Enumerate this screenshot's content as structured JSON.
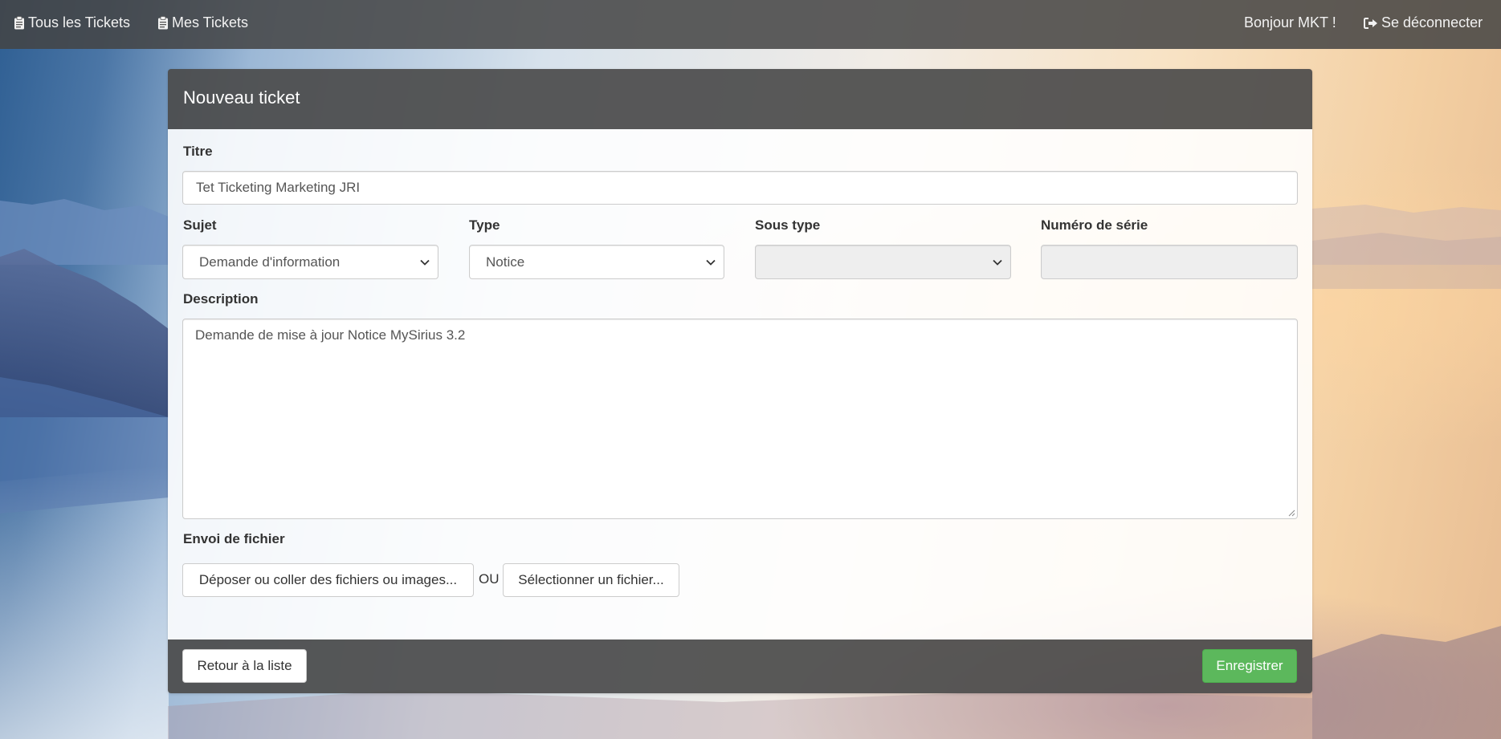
{
  "nav": {
    "all_tickets": "Tous les Tickets",
    "my_tickets": "Mes Tickets",
    "greeting": "Bonjour MKT !",
    "logout": "Se déconnecter"
  },
  "panel": {
    "title": "Nouveau ticket"
  },
  "form": {
    "titre_label": "Titre",
    "titre_value": "Tet Ticketing Marketing JRI",
    "sujet_label": "Sujet",
    "sujet_value": "Demande d'information",
    "type_label": "Type",
    "type_value": "Notice",
    "sous_type_label": "Sous type",
    "sous_type_value": "",
    "serial_label": "Numéro de série",
    "serial_value": "",
    "description_label": "Description",
    "description_value": "Demande de mise à jour Notice MySirius 3.2",
    "upload_label": "Envoi de fichier",
    "drop_button": "Déposer ou coller des fichiers ou images...",
    "or_text": "OU",
    "select_button": "Sélectionner un fichier..."
  },
  "footer": {
    "back_button": "Retour à la liste",
    "save_button": "Enregistrer"
  },
  "colors": {
    "navbar": "#444444",
    "success": "#5cb85c"
  },
  "icons": {
    "all_tickets": "clipboard-icon",
    "my_tickets": "clipboard-icon",
    "logout": "sign-out-icon",
    "select": "chevron-down-icon"
  }
}
